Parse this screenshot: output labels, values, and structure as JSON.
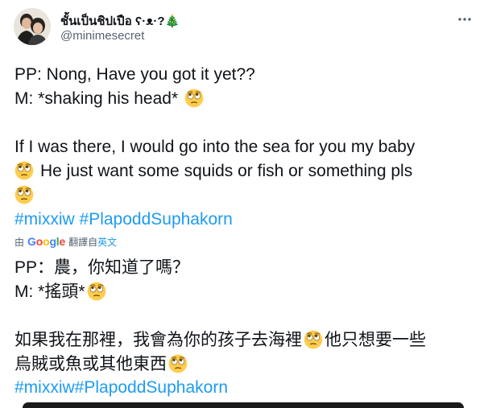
{
  "author": {
    "display_name": "ชั้นเป็นชิปเปือ ʕ·ᴥ·?🎄",
    "handle": "@minimesecret"
  },
  "tweet": {
    "line1": "PP: Nong, Have you got it yet??",
    "line2": "M: *shaking his head*",
    "line3": "If I was there, I would go into the sea for you my baby",
    "line4": "He just want some squids or fish or something pls",
    "hashtag1": "#mixxiw",
    "hashtag2": "#PlapoddSuphakorn"
  },
  "translation_bar": {
    "prefix": "由",
    "provider": "Google",
    "middle": "翻譯自",
    "source_language": "英文"
  },
  "translation": {
    "line1": "PP：農，你知道了嗎？",
    "line2": "M: *搖頭*",
    "line3": "如果我在那裡，我會為你的孩子去海裡",
    "line3b": "他只想要一些",
    "line4": "烏賊或魚或其他東西",
    "hashtags": "#mixxiw#PlapoddSuphakorn"
  },
  "colors": {
    "link": "#1d9bf0",
    "secondary_text": "#536471",
    "emoji_face": "#ffcc4d"
  },
  "icons": {
    "more": "more-options-icon",
    "emoji": "face-with-rolling-eyes-emoji"
  }
}
